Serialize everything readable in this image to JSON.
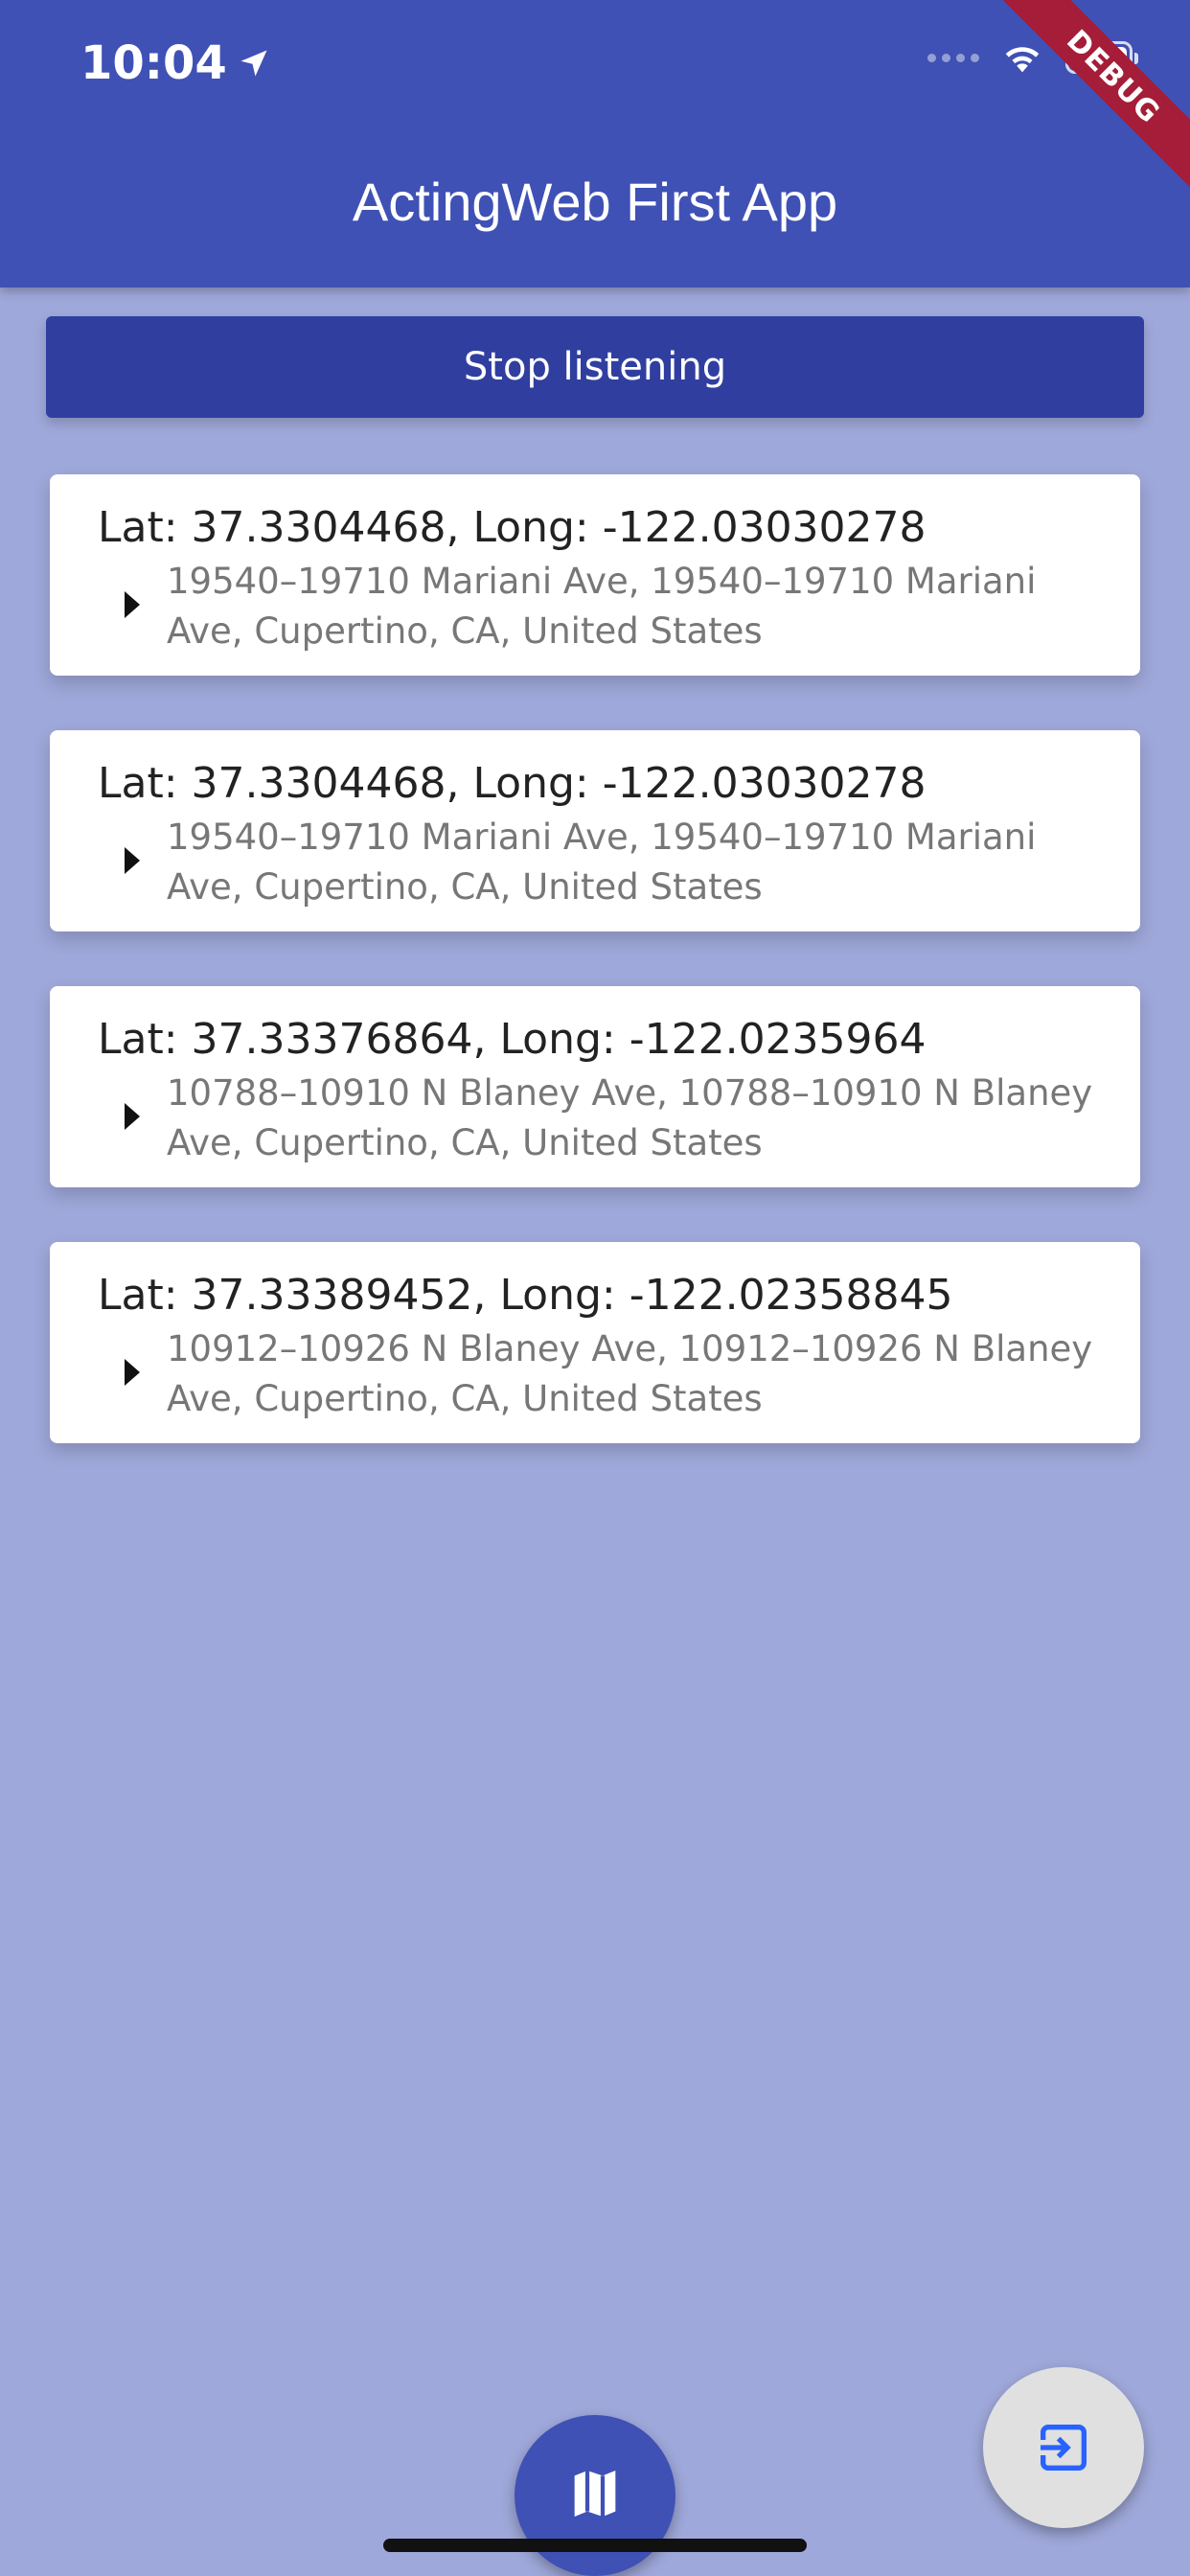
{
  "status_bar": {
    "time": "10:04",
    "location_icon": "location-arrow-icon",
    "wifi_icon": "wifi-icon",
    "battery_icon": "battery-icon"
  },
  "debug_banner": "DEBUG",
  "app_bar": {
    "title": "ActingWeb First App"
  },
  "stop_button": {
    "label": "Stop listening"
  },
  "locations": [
    {
      "coords": "Lat: 37.3304468, Long: -122.03030278",
      "address": "19540–19710 Mariani Ave, 19540–19710 Mariani Ave, Cupertino, CA, United States"
    },
    {
      "coords": "Lat: 37.3304468, Long: -122.03030278",
      "address": "19540–19710 Mariani Ave, 19540–19710 Mariani Ave, Cupertino, CA, United States"
    },
    {
      "coords": "Lat: 37.33376864, Long: -122.0235964",
      "address": "10788–10910 N Blaney Ave, 10788–10910 N Blaney Ave, Cupertino, CA, United States"
    },
    {
      "coords": "Lat: 37.33389452, Long: -122.02358845",
      "address": "10912–10926 N Blaney Ave, 10912–10926 N Blaney Ave, Cupertino, CA, United States"
    }
  ],
  "fab_map": {
    "icon": "map-icon"
  },
  "fab_exit": {
    "icon": "exit-icon"
  },
  "colors": {
    "primary": "#3F51B5",
    "primary_dark": "#303F9F",
    "background": "#9FA8DA",
    "debug": "#A51D38"
  }
}
